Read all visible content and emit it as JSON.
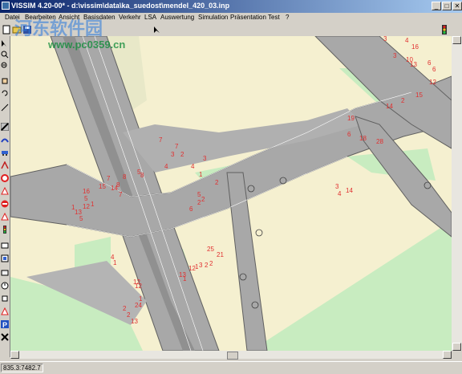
{
  "window": {
    "title": "VISSIM 4.20-00* - d:\\vissim\\data\\ka_suedost\\mendel_420_03.inp",
    "controls": [
      "_",
      "□",
      "✕"
    ]
  },
  "menu": [
    "Datei",
    "Bearbeiten",
    "Ansicht",
    "Basisdaten",
    "Verkehr",
    "LSA",
    "Auswertung",
    "Simulation",
    "Präsentation",
    "Test",
    "?"
  ],
  "watermark": {
    "text": "河东软件园",
    "url": "www.pc0359.cn"
  },
  "status": {
    "coordinates": "835.3:7482.7"
  },
  "network_labels": [
    "3",
    "4",
    "16",
    "3",
    "10",
    "13",
    "6",
    "6",
    "12",
    "15",
    "2",
    "14",
    "19",
    "6",
    "18",
    "28",
    "7",
    "7",
    "4",
    "3",
    "2",
    "4",
    "3",
    "1",
    "2",
    "5",
    "2",
    "6",
    "7",
    "8",
    "8",
    "5",
    "8",
    "15",
    "16",
    "5",
    "14",
    "1",
    "7",
    "3",
    "4",
    "14",
    "12",
    "2",
    "1",
    "13",
    "5",
    "4",
    "1",
    "12",
    "12",
    "25",
    "21",
    "13",
    "1",
    "12",
    "1",
    "3",
    "2",
    "2",
    "2",
    "2",
    "13",
    "24",
    "1"
  ],
  "icons": [
    "pointer-icon",
    "zoom-icon",
    "hand-icon",
    "link-icon",
    "signal-icon",
    "vehicle-icon",
    "stop-icon",
    "parking-icon",
    "traffic-light-icon"
  ]
}
